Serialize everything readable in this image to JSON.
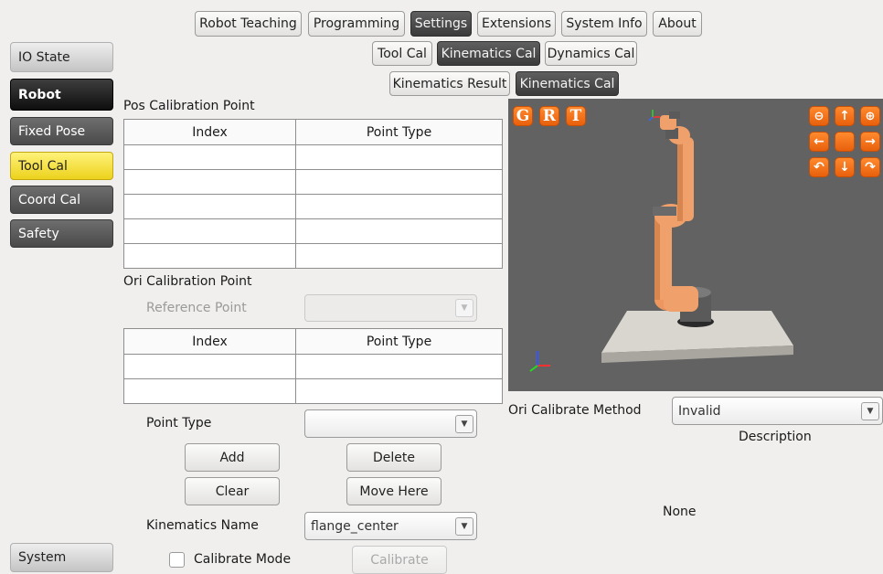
{
  "top_tabs": [
    "Robot Teaching",
    "Programming",
    "Settings",
    "Extensions",
    "System Info",
    "About"
  ],
  "sub_tabs": [
    "Tool Cal",
    "Kinematics Cal",
    "Dynamics Cal"
  ],
  "sub_sub_tabs": [
    "Kinematics Result",
    "Kinematics Cal"
  ],
  "sidebar": {
    "io_state": "IO State",
    "robot": "Robot",
    "items": [
      "Fixed Pose",
      "Tool Cal",
      "Coord Cal",
      "Safety"
    ],
    "system": "System"
  },
  "pos_section": {
    "title": "Pos Calibration Point",
    "headers": [
      "Index",
      "Point Type"
    ]
  },
  "ori_section": {
    "title": "Ori Calibration Point",
    "reference_label": "Reference Point",
    "reference_value": "",
    "headers": [
      "Index",
      "Point Type"
    ]
  },
  "form": {
    "point_type_label": "Point Type",
    "point_type_value": "",
    "add": "Add",
    "delete": "Delete",
    "clear": "Clear",
    "move_here": "Move Here",
    "kinematics_name_label": "Kinematics Name",
    "kinematics_name_value": "flange_center",
    "calibrate_mode": "Calibrate Mode",
    "calibrate": "Calibrate"
  },
  "viewport": {
    "mode_buttons": [
      "G",
      "R",
      "T"
    ]
  },
  "right_panel": {
    "method_label": "Ori Calibrate Method",
    "method_value": "Invalid",
    "description_label": "Description",
    "description_value": "None"
  },
  "colors": {
    "accent_orange": "#f07a1e",
    "tab_dark": "#4a4a4a",
    "active_yellow": "#f2dc3a",
    "viewport_bg": "#626262"
  }
}
